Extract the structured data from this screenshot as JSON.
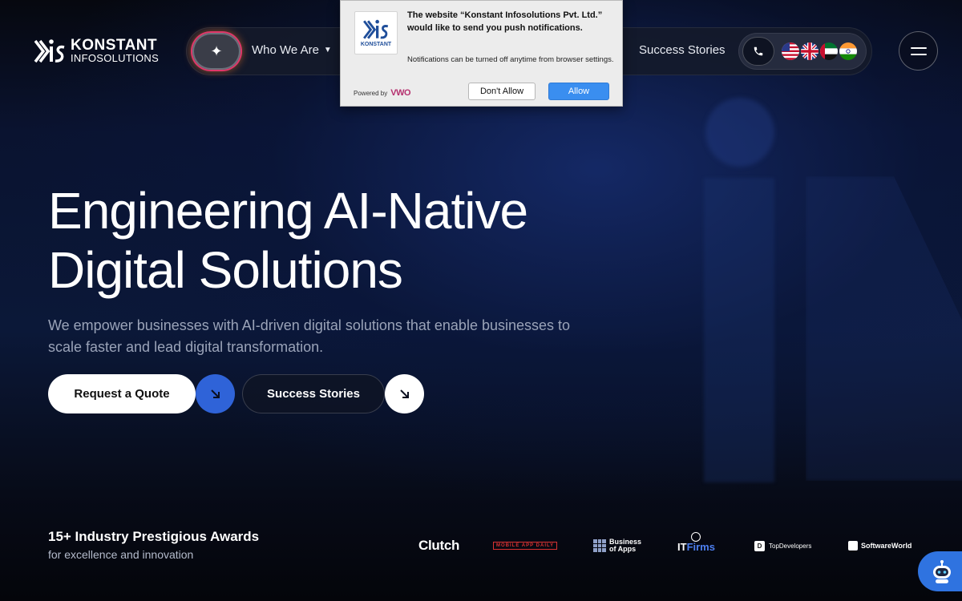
{
  "brand": {
    "name_line1": "KONSTANT",
    "name_line2": "INFOSOLUTIONS",
    "accent": "#2f63d8"
  },
  "nav": {
    "ai_icon": "sparkle-icon",
    "who_we_are": "Who We Are",
    "success_stories": "Success Stories",
    "phone_icon": "phone-icon",
    "flags": [
      "us-flag-icon",
      "uk-flag-icon",
      "uae-flag-icon",
      "india-flag-icon"
    ],
    "menu_icon": "hamburger-menu-icon"
  },
  "notification": {
    "title": "The website “Konstant Infosolutions Pvt. Ltd.” would like to send you push notifications.",
    "body": "Notifications can be turned off anytime from browser settings.",
    "powered_by": "Powered by",
    "powered_brand": "VWO",
    "deny_label": "Don't Allow",
    "allow_label": "Allow",
    "allow_color": "#3a8ef0"
  },
  "hero": {
    "title_line1": "Engineering AI-Native",
    "title_line2": "Digital Solutions",
    "subtitle": "We empower businesses with AI-driven digital solutions that enable businesses to scale faster and lead digital transformation.",
    "cta_primary": "Request a Quote",
    "cta_secondary": "Success Stories"
  },
  "awards": {
    "title": "15+ Industry Prestigious Awards",
    "subtitle": "for excellence and innovation",
    "logos": {
      "clutch": "Clutch",
      "mad": "MOBILE APP DAILY",
      "boa_line1": "Business",
      "boa_line2": "of Apps",
      "itfirms_a": "IT",
      "itfirms_b": "Firms",
      "topdevelopers": "TopDevelopers",
      "softwareworld": "SoftwareWorld"
    }
  },
  "chatbot_icon": "chatbot-robot-icon"
}
